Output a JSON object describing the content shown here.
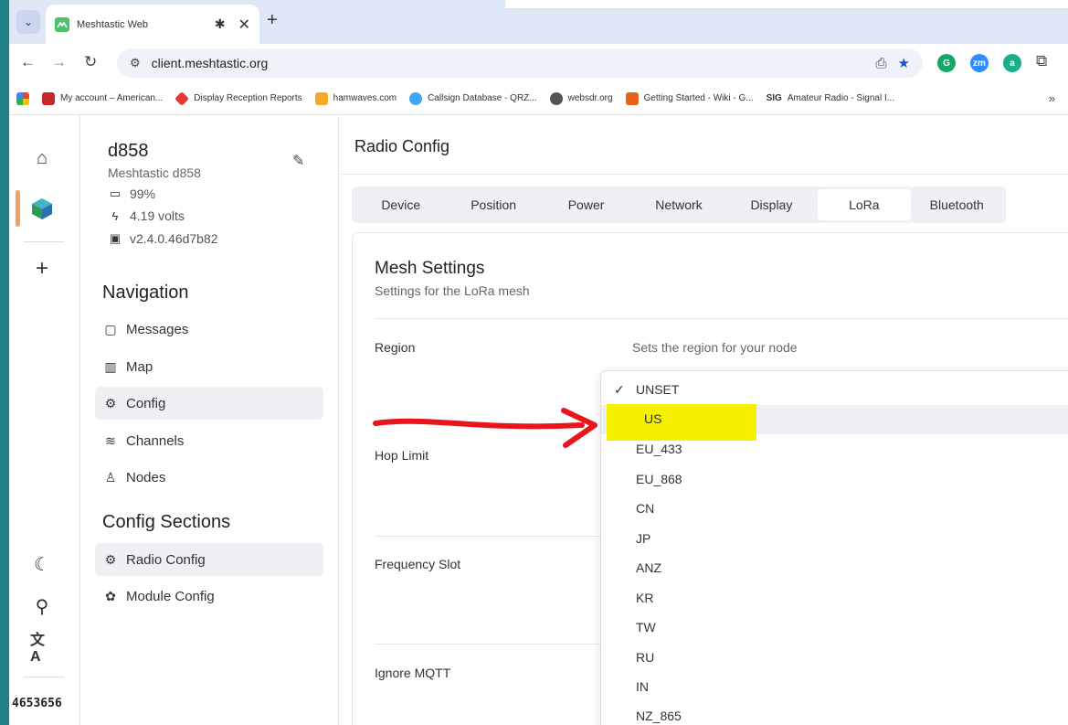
{
  "browser": {
    "tab_title": "Meshtastic Web",
    "url": "client.meshtastic.org",
    "bookmarks": [
      {
        "label": "My account – American...",
        "color": "#c62828"
      },
      {
        "label": "Display Reception Reports",
        "color": "#e53935"
      },
      {
        "label": "hamwaves.com",
        "color": "#f9a825"
      },
      {
        "label": "Callsign Database - QRZ...",
        "color": "#42a5f5"
      },
      {
        "label": "websdr.org",
        "color": "#555555"
      },
      {
        "label": "Getting Started - Wiki - G...",
        "color": "#e8631a"
      },
      {
        "label": "Amateur Radio - Signal I...",
        "color": "#222222"
      }
    ],
    "bookmark_sig": "SIG",
    "more": "»",
    "extensions": [
      {
        "name": "grammarly",
        "letter": "G",
        "color": "#15a869"
      },
      {
        "name": "zoom",
        "letter": "zm",
        "color": "#2d8cff"
      },
      {
        "name": "a-ext",
        "letter": "a",
        "color": "#1cb08a"
      }
    ]
  },
  "rail": {
    "node_id": "4653656"
  },
  "node": {
    "short_name": "d858",
    "long_name": "Meshtastic d858",
    "battery": "99%",
    "voltage": "4.19 volts",
    "firmware": "v2.4.0.46d7b82"
  },
  "navigation": {
    "heading": "Navigation",
    "items": [
      {
        "label": "Messages",
        "icon": "message-icon"
      },
      {
        "label": "Map",
        "icon": "map-icon"
      },
      {
        "label": "Config",
        "icon": "gear-icon"
      },
      {
        "label": "Channels",
        "icon": "layers-icon"
      },
      {
        "label": "Nodes",
        "icon": "users-icon"
      }
    ]
  },
  "config_sections": {
    "heading": "Config Sections",
    "items": [
      {
        "label": "Radio Config",
        "icon": "gear-icon"
      },
      {
        "label": "Module Config",
        "icon": "modules-icon"
      }
    ]
  },
  "main": {
    "title": "Radio Config",
    "tabs": [
      "Device",
      "Position",
      "Power",
      "Network",
      "Display",
      "LoRa",
      "Bluetooth"
    ],
    "selected_tab": "LoRa",
    "card": {
      "title": "Mesh Settings",
      "subtitle": "Settings for the LoRa mesh",
      "fields": {
        "region": "Region",
        "region_desc": "Sets the region for your node",
        "hop_limit": "Hop Limit",
        "frequency_slot": "Frequency Slot",
        "ignore_mqtt": "Ignore MQTT"
      }
    }
  },
  "region_dropdown": {
    "selected": "UNSET",
    "highlighted": "US",
    "options": [
      "UNSET",
      "US",
      "EU_433",
      "EU_868",
      "CN",
      "JP",
      "ANZ",
      "KR",
      "TW",
      "RU",
      "IN",
      "NZ_865"
    ]
  },
  "colors": {
    "annotation_arrow": "#e8151b",
    "highlight": "#f5ef00",
    "accent": "#f2a161"
  }
}
